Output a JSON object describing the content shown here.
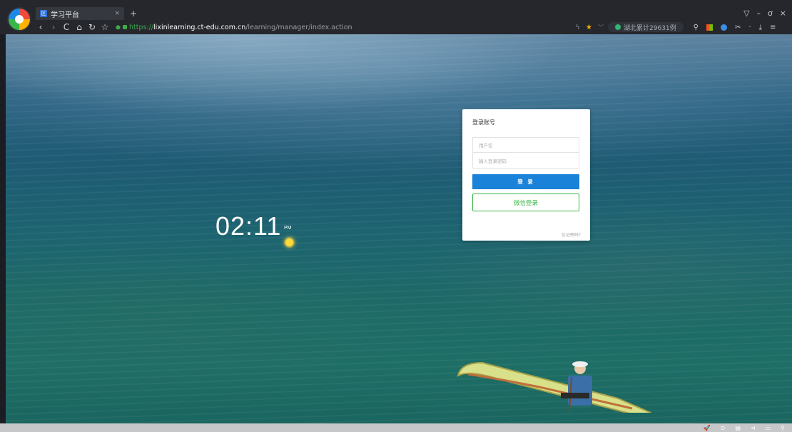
{
  "browser": {
    "tab_title": "学习平台",
    "tab_favicon": "区",
    "tab_close": "×",
    "new_tab": "+",
    "window_controls": {
      "skin": "▽",
      "minimize": "–",
      "maximize": "ơ",
      "close": "×"
    },
    "nav": {
      "back": "‹",
      "forward": "›",
      "reload": "C",
      "home": "⌂",
      "undo": "↻",
      "favorite": "☆"
    },
    "address": {
      "scheme": "https://",
      "host": "lixinlearning.ct-edu.com.cn",
      "path": "/learning/manager/index.action"
    },
    "addr_right": {
      "bolt": "ϟ",
      "star": "★",
      "chevron": "﹀"
    },
    "news_pill": "湖北累计29631例",
    "tools": {
      "search": "⚲",
      "scissors": "✂",
      "dot": "·",
      "download": "⤓",
      "menu": "≡"
    }
  },
  "clock": {
    "time": "02:11",
    "ampm": "PM"
  },
  "login": {
    "title": "登录账号",
    "username_placeholder": "用户名",
    "password_placeholder": "输入登录密码",
    "login_label": "登 录",
    "wechat_label": "微信登录",
    "forgot_label": "忘记密码?"
  },
  "status_bar": {
    "icons": [
      "🚀",
      "⊙",
      "▤",
      "⊲",
      "▭",
      "⚲"
    ]
  }
}
